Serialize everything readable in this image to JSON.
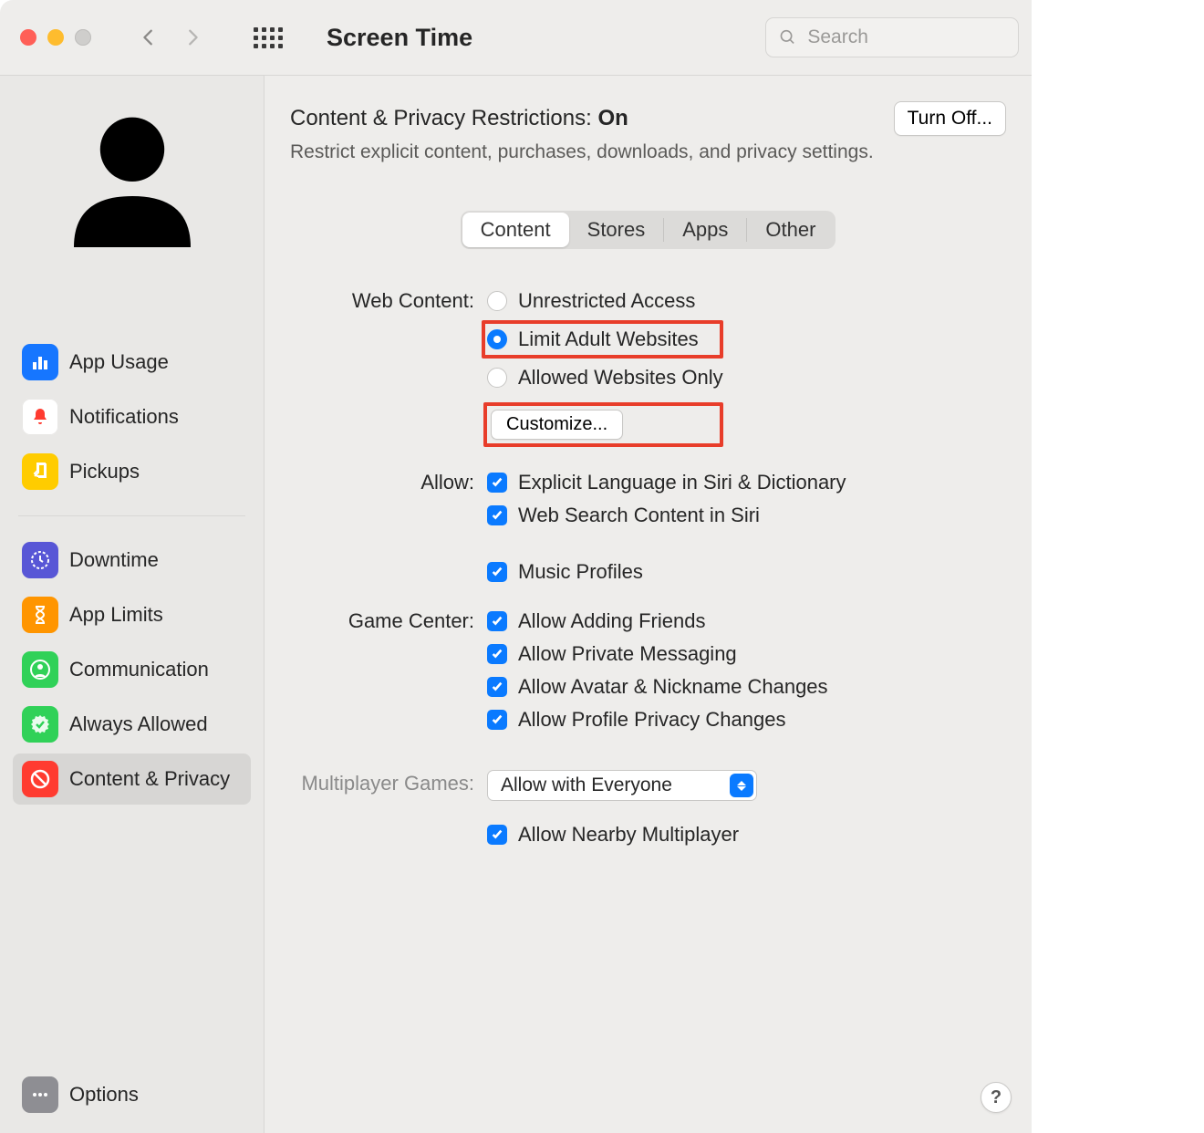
{
  "window": {
    "title": "Screen Time",
    "search_placeholder": "Search"
  },
  "sidebar": {
    "items": [
      {
        "label": "App Usage"
      },
      {
        "label": "Notifications"
      },
      {
        "label": "Pickups"
      }
    ],
    "items2": [
      {
        "label": "Downtime"
      },
      {
        "label": "App Limits"
      },
      {
        "label": "Communication"
      },
      {
        "label": "Always Allowed"
      },
      {
        "label": "Content & Privacy"
      }
    ],
    "options_label": "Options"
  },
  "header": {
    "title_prefix": "Content & Privacy Restrictions: ",
    "state": "On",
    "desc": "Restrict explicit content, purchases, downloads, and privacy settings.",
    "turn_off": "Turn Off..."
  },
  "tabs": {
    "content": "Content",
    "stores": "Stores",
    "apps": "Apps",
    "other": "Other"
  },
  "sections": {
    "web_content_label": "Web Content:",
    "web_options": {
      "unrestricted": "Unrestricted Access",
      "limit_adult": "Limit Adult Websites",
      "allowed_only": "Allowed Websites Only"
    },
    "customize_btn": "Customize...",
    "allow_label": "Allow:",
    "allow_options": {
      "siri_explicit": "Explicit Language in Siri & Dictionary",
      "siri_web": "Web Search Content in Siri",
      "music": "Music Profiles"
    },
    "game_center_label": "Game Center:",
    "game_center_options": {
      "friends": "Allow Adding Friends",
      "messaging": "Allow Private Messaging",
      "avatar": "Allow Avatar & Nickname Changes",
      "profile": "Allow Profile Privacy Changes"
    },
    "multiplayer_label": "Multiplayer Games:",
    "multiplayer_value": "Allow with Everyone",
    "nearby": "Allow Nearby Multiplayer"
  },
  "help": "?"
}
